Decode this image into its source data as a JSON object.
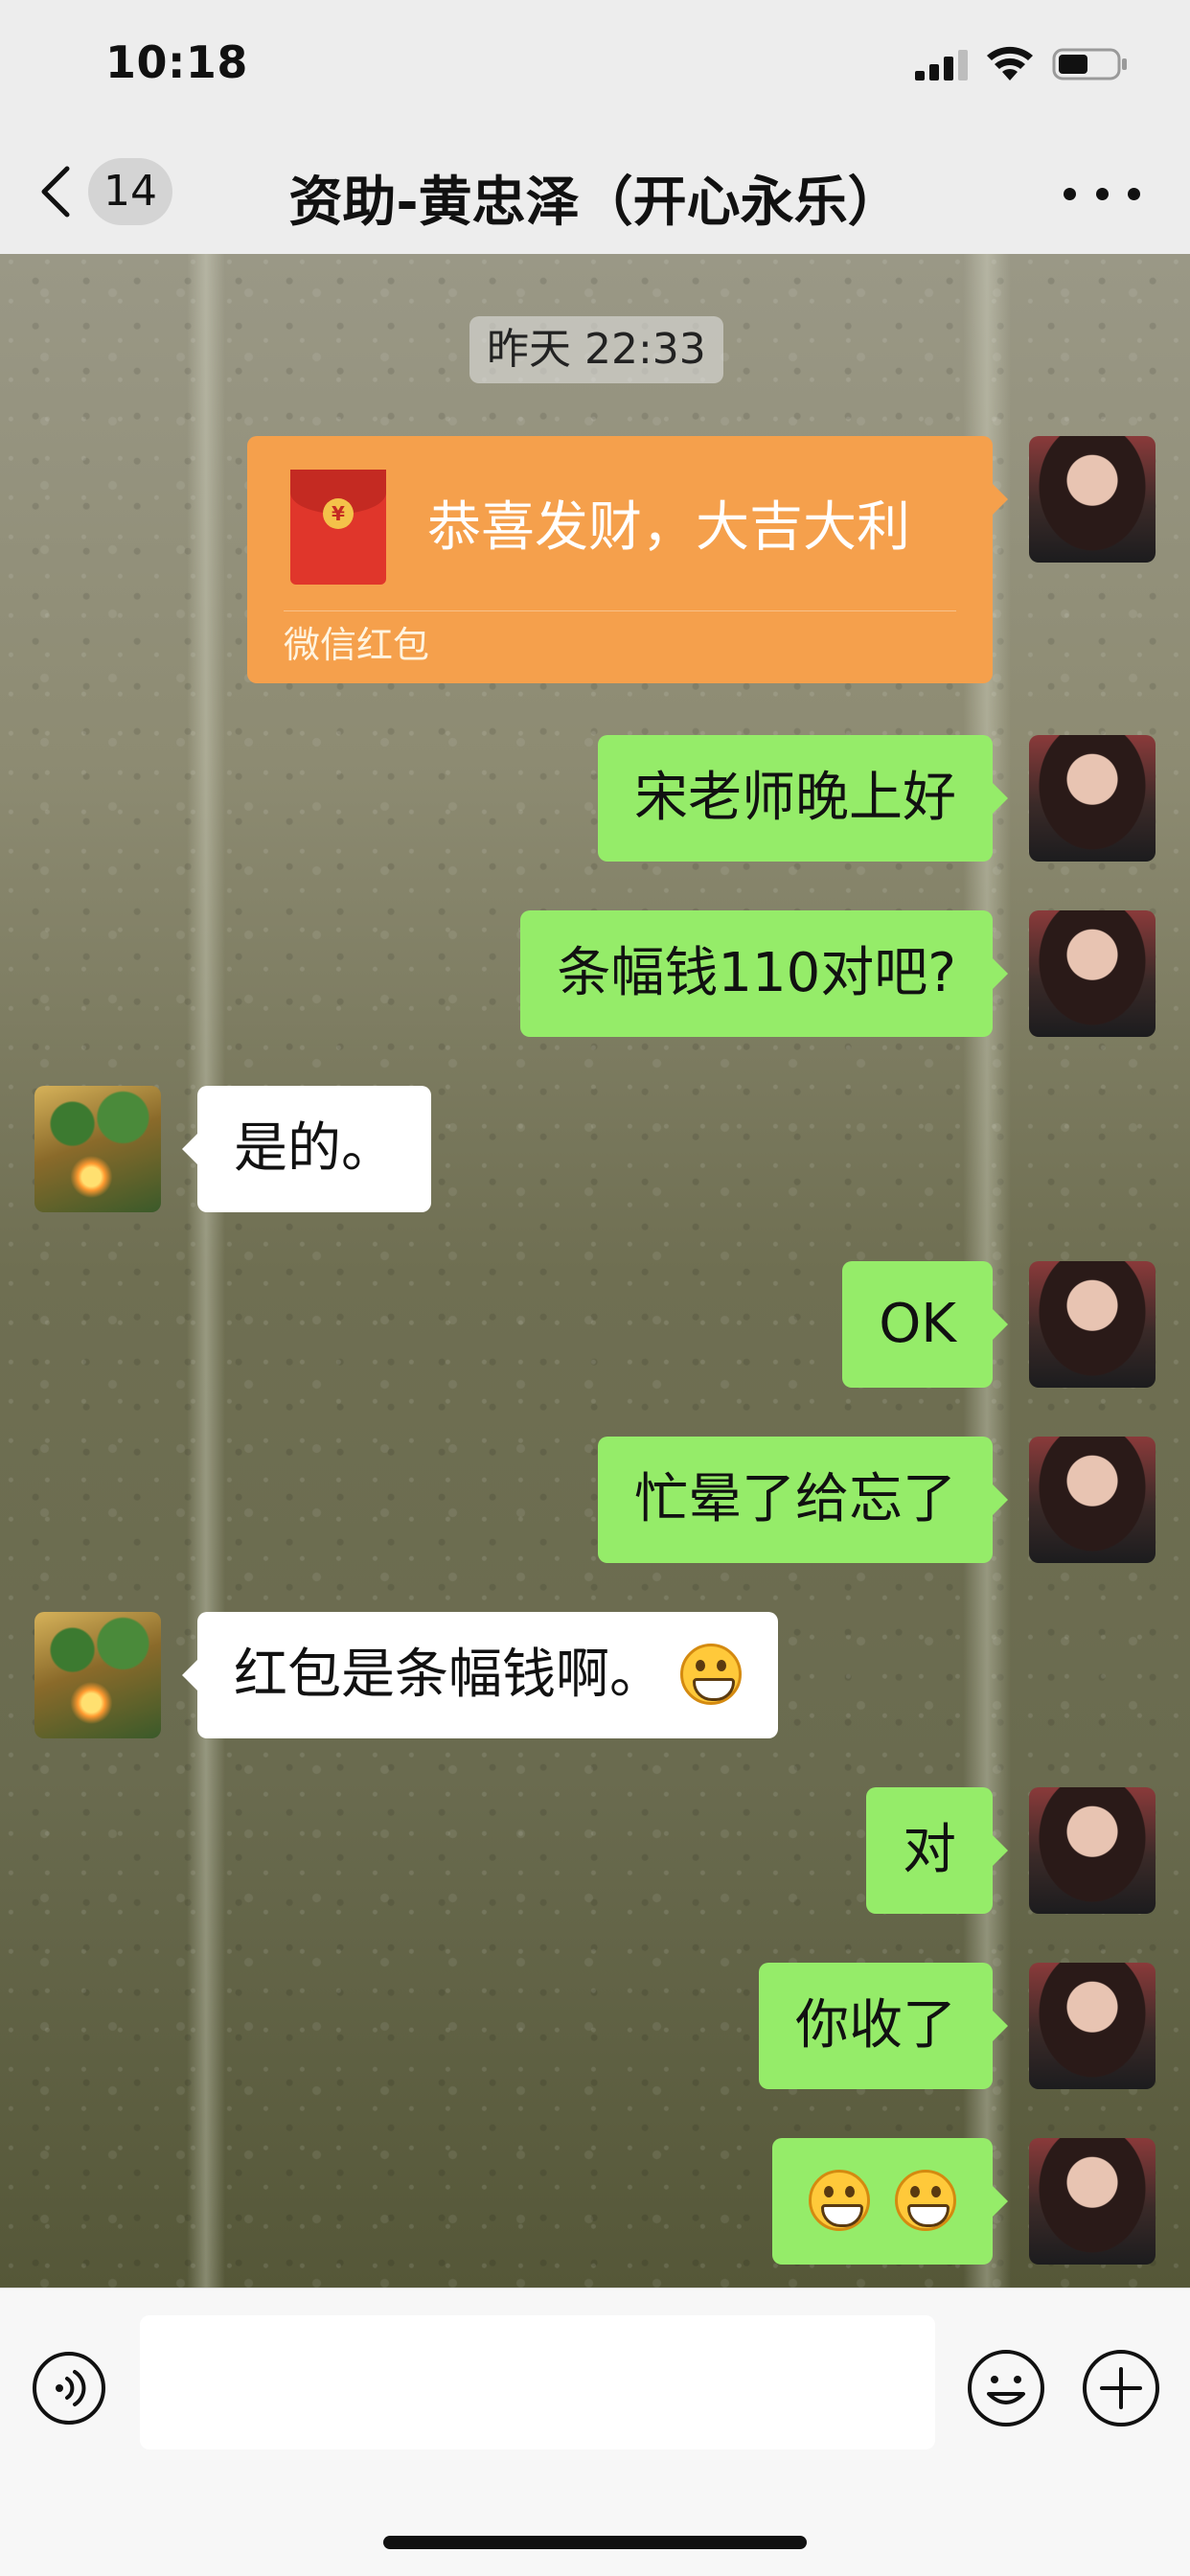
{
  "status_bar": {
    "time": "10:18"
  },
  "nav": {
    "back_badge": "14",
    "title": "资助-黄忠泽（开心永乐）"
  },
  "chat": {
    "timestamp": "昨天 22:33",
    "red_packet": {
      "title": "恭喜发财，大吉大利",
      "footer": "微信红包",
      "coin": "¥"
    },
    "messages": [
      {
        "from": "me",
        "text": "宋老师晚上好"
      },
      {
        "from": "me",
        "text": "条幅钱110对吧?"
      },
      {
        "from": "other",
        "text": "是的。"
      },
      {
        "from": "me",
        "text": "OK"
      },
      {
        "from": "me",
        "text": "忙晕了给忘了"
      },
      {
        "from": "other",
        "text": "红包是条幅钱啊。",
        "emoji": "grin"
      },
      {
        "from": "me",
        "text": "对"
      },
      {
        "from": "me",
        "text": "你收了"
      },
      {
        "from": "me",
        "text": "",
        "emoji": "grin x2"
      }
    ]
  },
  "input_bar": {
    "value": "",
    "placeholder": ""
  },
  "colors": {
    "bubble_me": "#95ec69",
    "bubble_other": "#ffffff",
    "red_packet": "#f5a04c",
    "bar_bg": "#ededed"
  },
  "icons": [
    "signal-icon",
    "wifi-icon",
    "battery-icon",
    "back-chevron-icon",
    "more-icon",
    "voice-icon",
    "emoji-icon",
    "plus-icon",
    "red-packet-icon",
    "grin-emoji-icon"
  ]
}
